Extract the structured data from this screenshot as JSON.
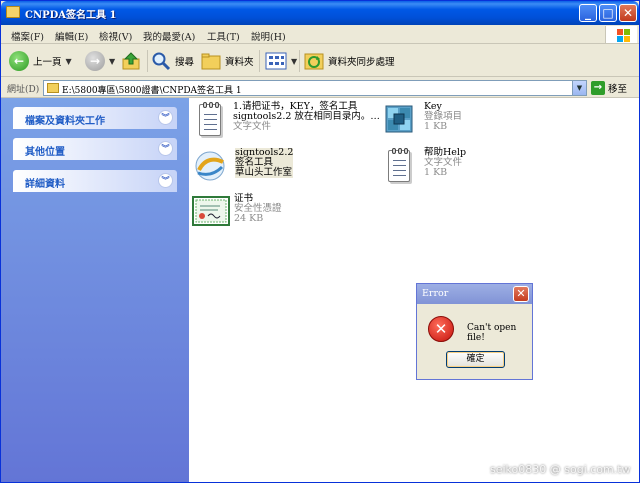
{
  "window": {
    "title": "CNPDA签名工具 1",
    "controls": {
      "minimize": "_",
      "maximize": "□",
      "close": "✕"
    }
  },
  "menu": [
    "檔案(F)",
    "編輯(E)",
    "檢視(V)",
    "我的最愛(A)",
    "工具(T)",
    "說明(H)"
  ],
  "toolbar": {
    "back": "上一頁",
    "search": "搜尋",
    "folders": "資料夾",
    "sync": "資料夾同步處理"
  },
  "address": {
    "label": "網址(D)",
    "path": "E:\\5800專區\\5800證書\\CNPDA签名工具 1",
    "go": "移至"
  },
  "tasks": [
    {
      "title": "檔案及資料夾工作"
    },
    {
      "title": "其他位置"
    },
    {
      "title": "詳細資料"
    }
  ],
  "files": [
    {
      "line1": "1.请把证书，KEY，签名工具",
      "line2": "signtools2.2 放在相同目录内。…",
      "line3": "文字文件",
      "icon": "text-file-icon"
    },
    {
      "line1": "Key",
      "line2": "登錄項目",
      "line3": "1 KB",
      "icon": "registry-icon"
    },
    {
      "line1": "signtools2.2",
      "line2": "签名工具",
      "line3": "草山头工作室",
      "icon": "signtools-icon"
    },
    {
      "line1": "帮助Help",
      "line2": "文字文件",
      "line3": "1 KB",
      "icon": "text-file-icon"
    },
    {
      "line1": "证书",
      "line2": "安全性憑證",
      "line3": "24 KB",
      "icon": "certificate-icon"
    }
  ],
  "dialog": {
    "title": "Error",
    "message": "Can't open file!",
    "ok": "確定"
  },
  "watermark": "seiko0830 @ sogi.com.tw"
}
